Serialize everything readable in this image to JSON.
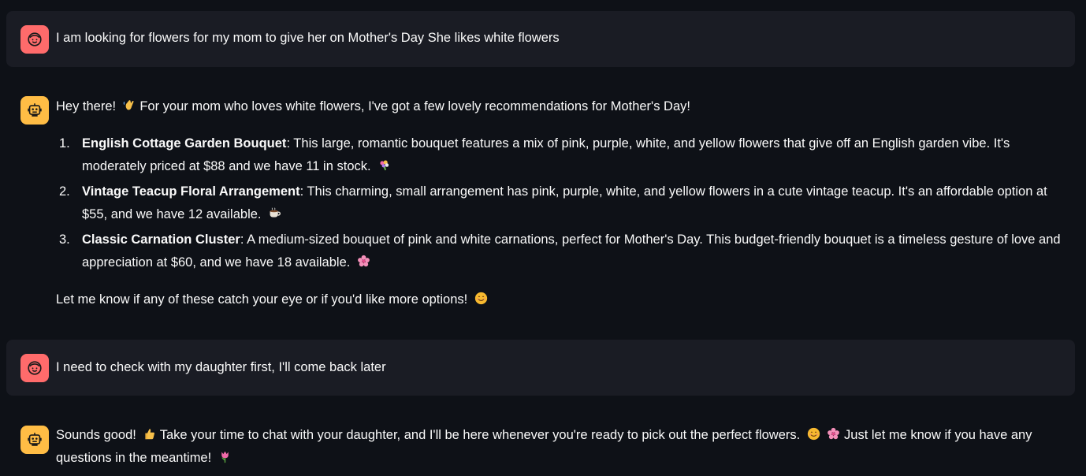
{
  "messages": [
    {
      "role": "user",
      "avatar_icon": "user-face-icon",
      "text": "I am looking for flowers for my mom to give her on Mother's Day She likes white flowers"
    },
    {
      "role": "assistant",
      "avatar_icon": "robot-icon",
      "intro": "Hey there!",
      "intro_emoji": "waving-hand-emoji",
      "intro_rest": "For your mom who loves white flowers, I've got a few lovely recommendations for Mother's Day!",
      "items": [
        {
          "number": "1.",
          "name": "English Cottage Garden Bouquet",
          "desc": ": This large, romantic bouquet features a mix of pink, purple, white, and yellow flowers that give off an English garden vibe. It's moderately priced at $88 and we have 11 in stock.",
          "emoji": "bouquet-emoji"
        },
        {
          "number": "2.",
          "name": "Vintage Teacup Floral Arrangement",
          "desc": ": This charming, small arrangement has pink, purple, white, and yellow flowers in a cute vintage teacup. It's an affordable option at $55, and we have 12 available.",
          "emoji": "teacup-emoji"
        },
        {
          "number": "3.",
          "name": "Classic Carnation Cluster",
          "desc": ": A medium-sized bouquet of pink and white carnations, perfect for Mother's Day. This budget-friendly bouquet is a timeless gesture of love and appreciation at $60, and we have 18 available.",
          "emoji": "cherry-blossom-emoji"
        }
      ],
      "outro": "Let me know if any of these catch your eye or if you'd like more options!",
      "outro_emoji": "smiling-face-emoji"
    },
    {
      "role": "user",
      "avatar_icon": "user-face-icon",
      "text": "I need to check with my daughter first, I'll come back later"
    },
    {
      "role": "assistant",
      "avatar_icon": "robot-icon",
      "part1": "Sounds good!",
      "emoji1": "thumbs-up-emoji",
      "part2": "Take your time to chat with your daughter, and I'll be here whenever you're ready to pick out the perfect flowers.",
      "emoji2": "smiling-face-emoji",
      "emoji3": "cherry-blossom-emoji",
      "part3": "Just let me know if you have any questions in the meantime!",
      "emoji4": "tulip-emoji"
    }
  ],
  "colors": {
    "background": "#0e1117",
    "user_bubble": "#1a1c24",
    "user_avatar": "#ff6b6b",
    "assistant_avatar": "#ffbd45",
    "text": "#fafafa"
  }
}
